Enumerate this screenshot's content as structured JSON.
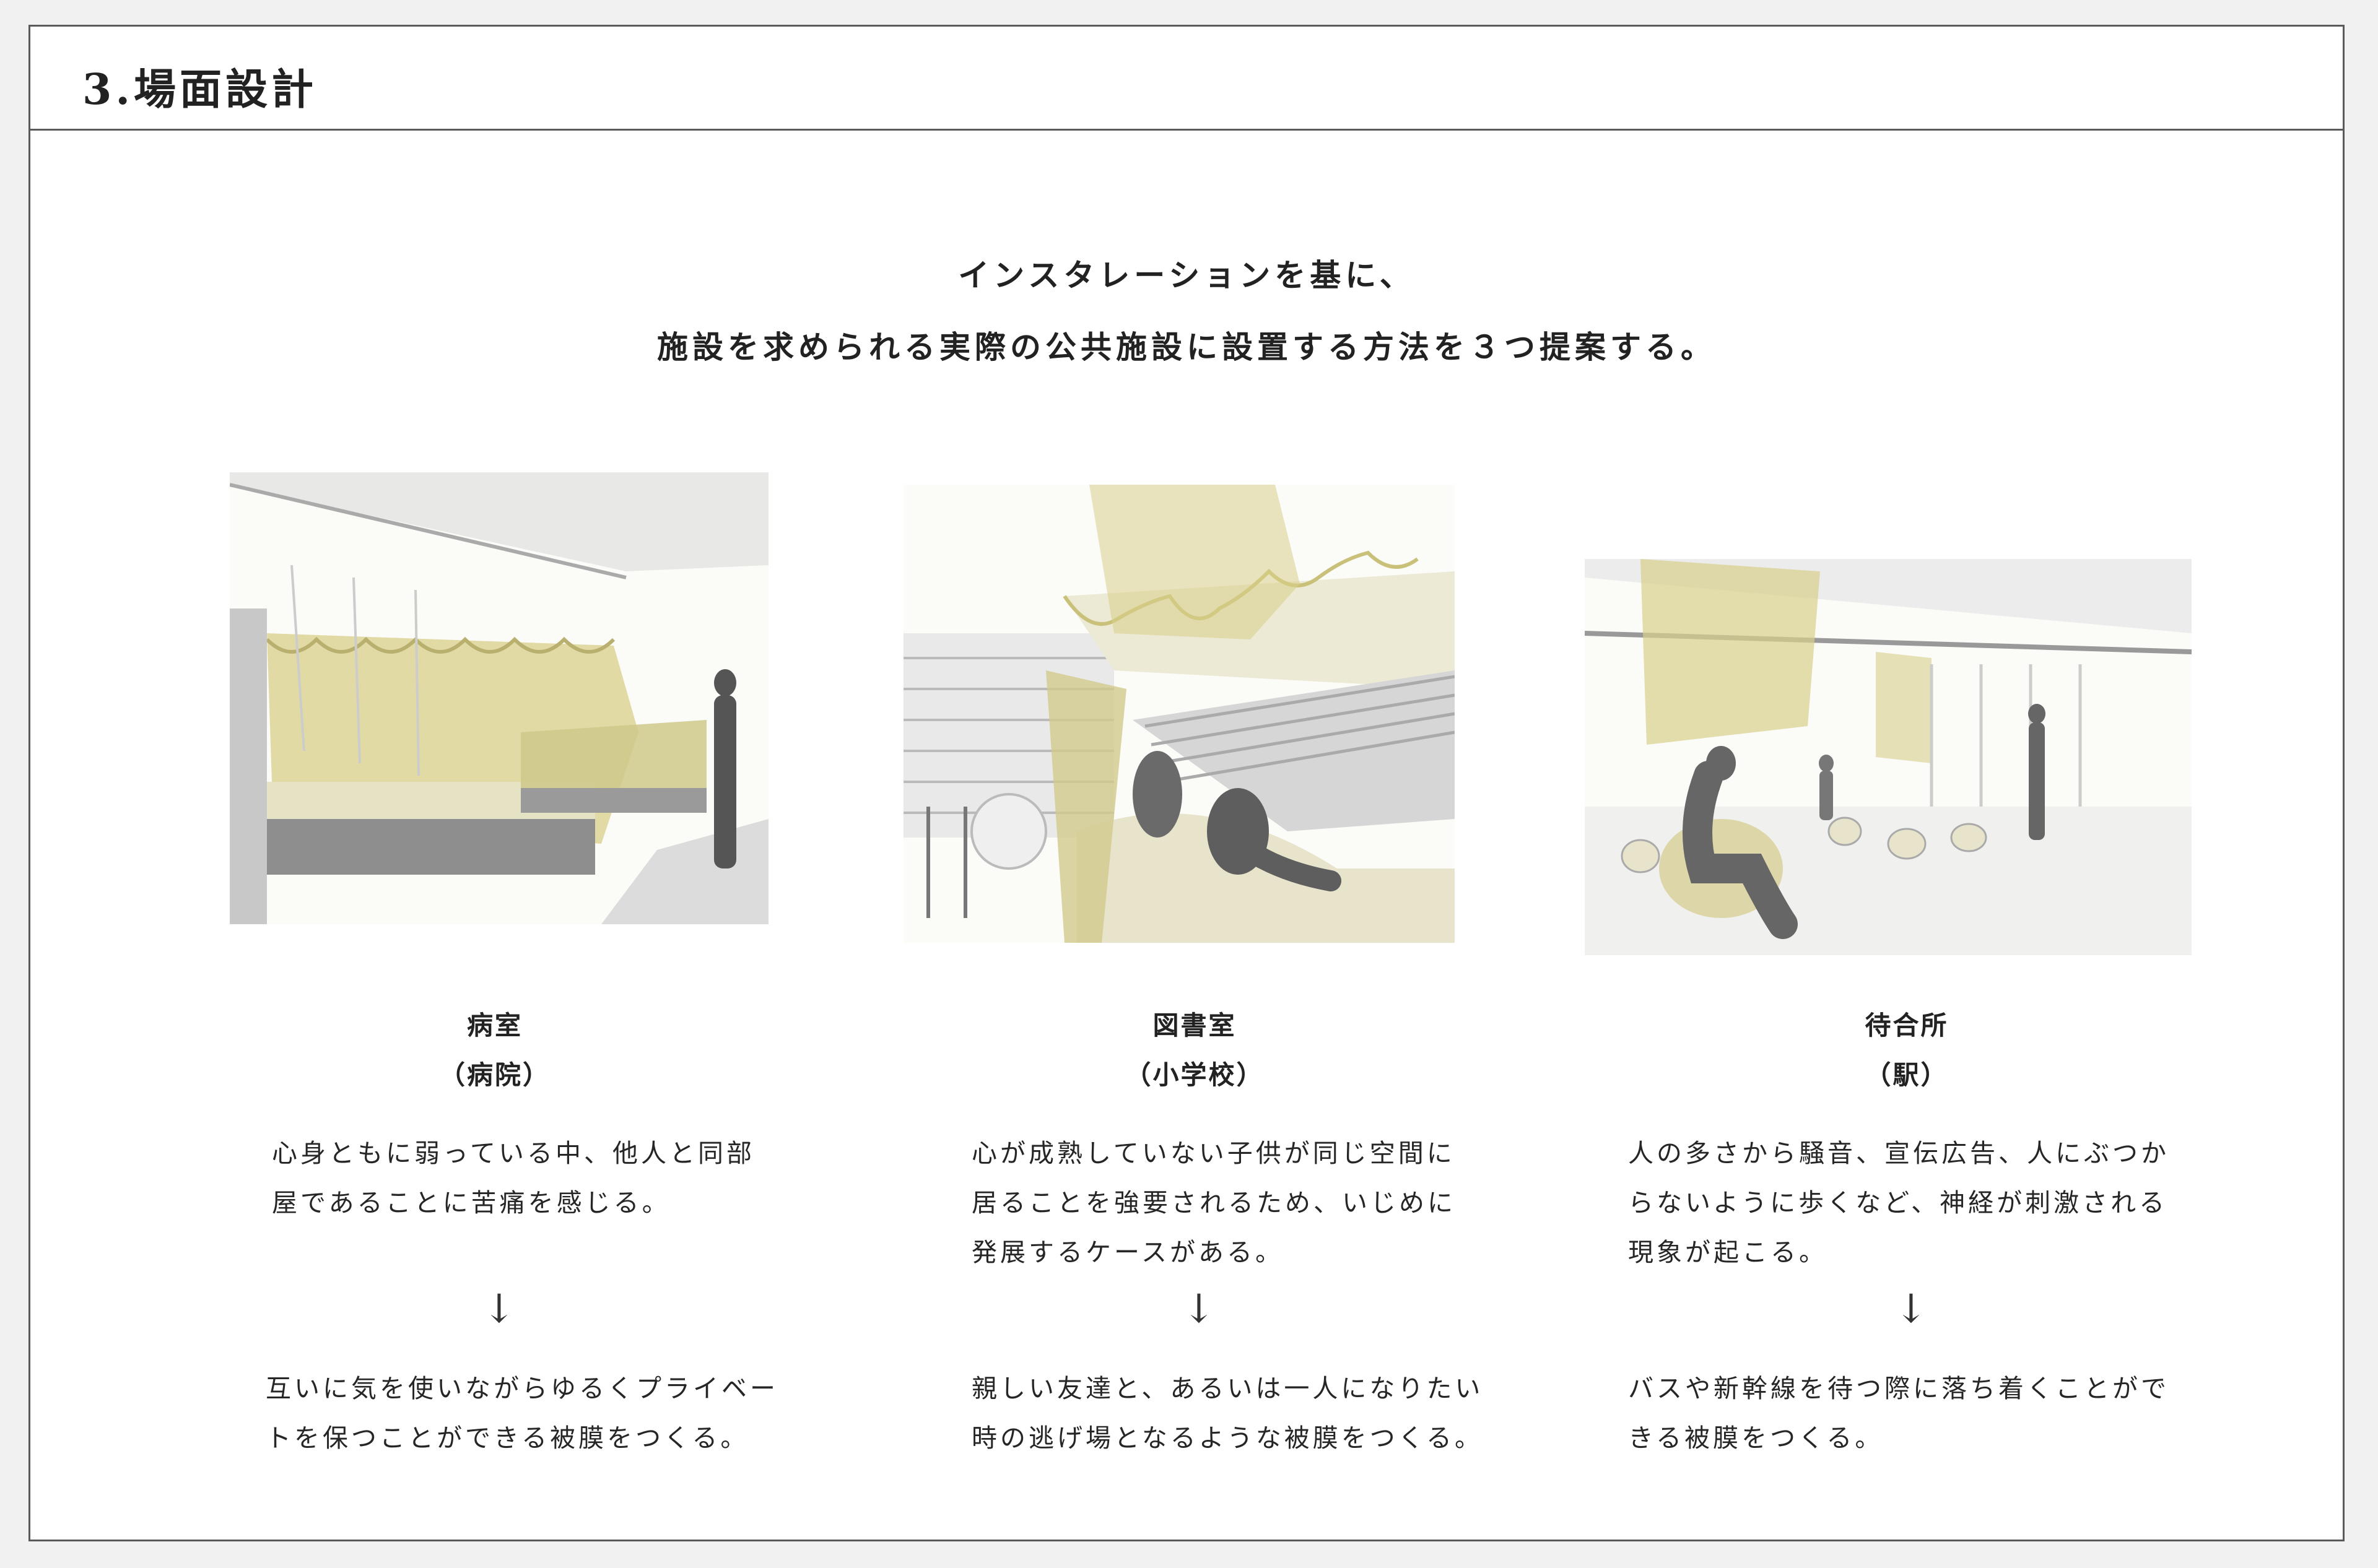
{
  "header": {
    "title": "3.場面設計"
  },
  "lead": {
    "line1": "インスタレーションを基に、",
    "line2": "施設を求められる実際の公共施設に設置する方法を３つ提案する。"
  },
  "arrow_glyph": "↓",
  "scenes": [
    {
      "place": "病室",
      "facility": "（病院）",
      "problem": "心身ともに弱っている中、他人と同部\n屋であることに苦痛を感じる。",
      "proposal": "互いに気を使いながらゆるくプライベー\nトを保つことができる被膜をつくる。"
    },
    {
      "place": "図書室",
      "facility": "（小学校）",
      "problem": "心が成熟していない子供が同じ空間に\n居ることを強要されるため、いじめに\n発展するケースがある。",
      "proposal": "親しい友達と、あるいは一人になりたい\n時の逃げ場となるような被膜をつくる。"
    },
    {
      "place": "待合所",
      "facility": "（駅）",
      "problem": "人の多さから騒音、宣伝広告、人にぶつか\nらないように歩くなど、神経が刺激される\n現象が起こる。",
      "proposal": "バスや新幹線を待つ際に落ち着くことがで\nきる被膜をつくる。"
    }
  ],
  "colors": {
    "page_background": "#f1f1f1",
    "sheet_background": "#ffffff",
    "frame_line": "#5a5a5a",
    "wash_yellow": "#d8cf8a",
    "wash_grey": "#9a9a9a"
  }
}
